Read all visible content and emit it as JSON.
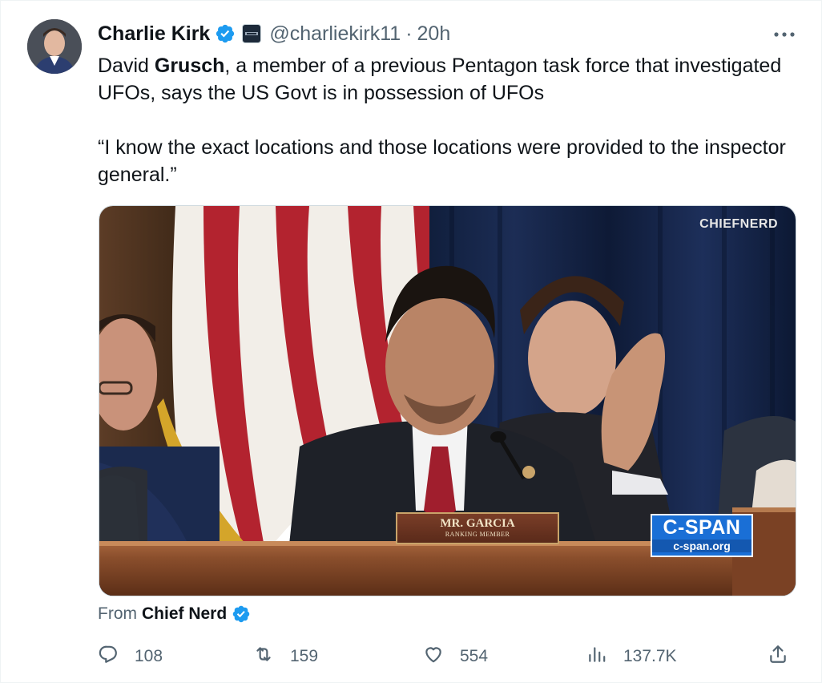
{
  "tweet": {
    "author_name": "Charlie Kirk",
    "handle": "@charliekirk11",
    "separator": "·",
    "time": "20h",
    "text_line1_prefix": "David ",
    "text_line1_bold": "Grusch",
    "text_line1_rest": ", a member of a previous Pentagon task force that investigated UFOs, says the US Govt is in possession of UFOs",
    "quote": "“I know the exact locations and those locations were provided to the inspector general.”"
  },
  "media": {
    "watermark": "CHIEFNERD",
    "nameplate_name": "MR. GARCIA",
    "nameplate_role": "RANKING MEMBER",
    "cspan_logo": "C-SPAN",
    "cspan_url": "c-span.org"
  },
  "attribution": {
    "prefix": "From",
    "source_name": "Chief Nerd"
  },
  "actions": {
    "replies": "108",
    "retweets": "159",
    "likes": "554",
    "views": "137.7K"
  },
  "icons": {
    "verified": "verified-badge-icon",
    "more": "more-options-icon",
    "reply": "reply-icon",
    "retweet": "retweet-icon",
    "like": "heart-icon",
    "views": "views-chart-icon",
    "share": "share-icon"
  },
  "colors": {
    "verified_blue": "#1d9bf0",
    "text_primary": "#0f1419",
    "text_secondary": "#536471",
    "cspan_blue": "#1a6fd6"
  }
}
